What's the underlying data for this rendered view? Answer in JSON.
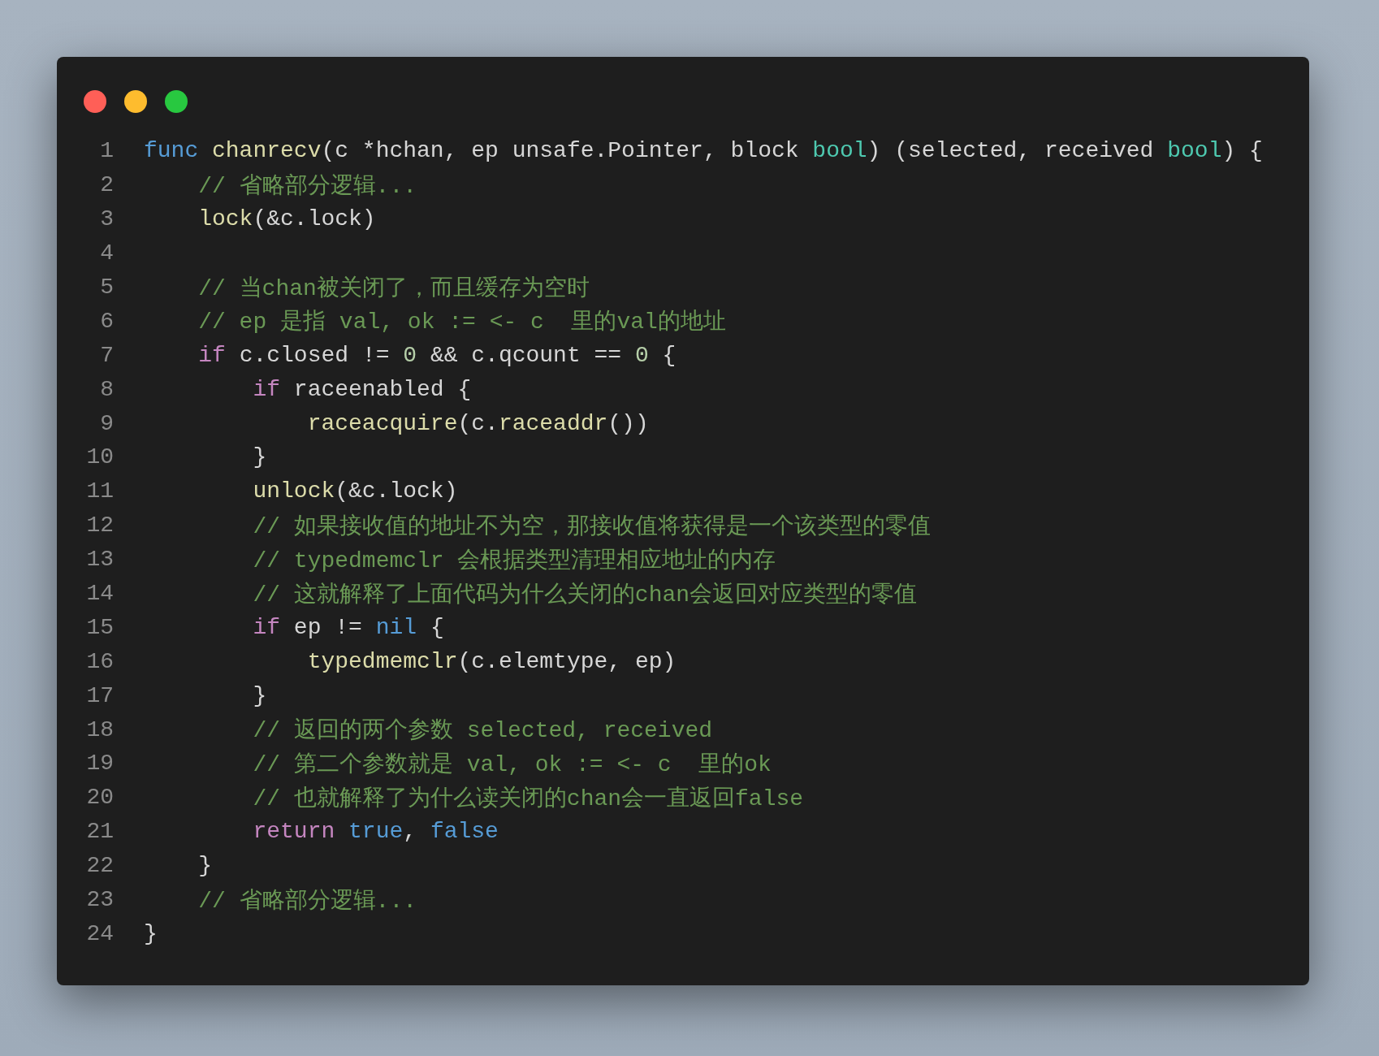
{
  "window": {
    "controls": [
      {
        "color": "#ff5f57"
      },
      {
        "color": "#febc2e"
      },
      {
        "color": "#28c840"
      }
    ]
  },
  "lines": [
    {
      "number": "1",
      "tokens": [
        {
          "kind": "storage",
          "text": "func "
        },
        {
          "kind": "function",
          "text": "chanrecv"
        },
        {
          "kind": "plain",
          "text": "(c *hchan, ep unsafe.Pointer, block "
        },
        {
          "kind": "type",
          "text": "bool"
        },
        {
          "kind": "plain",
          "text": ") (selected, received "
        },
        {
          "kind": "type",
          "text": "bool"
        },
        {
          "kind": "plain",
          "text": ") {"
        }
      ]
    },
    {
      "number": "2",
      "tokens": [
        {
          "kind": "comment",
          "text": "    // 省略部分逻辑..."
        }
      ]
    },
    {
      "number": "3",
      "tokens": [
        {
          "kind": "function",
          "text": "    lock"
        },
        {
          "kind": "plain",
          "text": "(&c.lock)"
        }
      ]
    },
    {
      "number": "4"
    },
    {
      "number": "5",
      "tokens": [
        {
          "kind": "comment",
          "text": "    // 当chan被关闭了，而且缓存为空时"
        }
      ]
    },
    {
      "number": "6",
      "tokens": [
        {
          "kind": "comment",
          "text": "    // ep 是指 val, ok := <- c  里的val的地址"
        }
      ]
    },
    {
      "number": "7",
      "tokens": [
        {
          "kind": "keyword",
          "text": "    if"
        },
        {
          "kind": "plain",
          "text": " c.closed != "
        },
        {
          "kind": "number",
          "text": "0"
        },
        {
          "kind": "plain",
          "text": " && c.qcount == "
        },
        {
          "kind": "number",
          "text": "0"
        },
        {
          "kind": "plain",
          "text": " {"
        }
      ]
    },
    {
      "number": "8",
      "tokens": [
        {
          "kind": "keyword",
          "text": "        if"
        },
        {
          "kind": "plain",
          "text": " raceenabled {"
        }
      ]
    },
    {
      "number": "9",
      "tokens": [
        {
          "kind": "function",
          "text": "            raceacquire"
        },
        {
          "kind": "plain",
          "text": "(c."
        },
        {
          "kind": "function",
          "text": "raceaddr"
        },
        {
          "kind": "plain",
          "text": "())"
        }
      ]
    },
    {
      "number": "10",
      "tokens": [
        {
          "kind": "plain",
          "text": "        }"
        }
      ]
    },
    {
      "number": "11",
      "tokens": [
        {
          "kind": "function",
          "text": "        unlock"
        },
        {
          "kind": "plain",
          "text": "(&c.lock)"
        }
      ]
    },
    {
      "number": "12",
      "tokens": [
        {
          "kind": "comment",
          "text": "        // 如果接收值的地址不为空，那接收值将获得是一个该类型的零值"
        }
      ]
    },
    {
      "number": "13",
      "tokens": [
        {
          "kind": "comment",
          "text": "        // typedmemclr 会根据类型清理相应地址的内存"
        }
      ]
    },
    {
      "number": "14",
      "tokens": [
        {
          "kind": "comment",
          "text": "        // 这就解释了上面代码为什么关闭的chan会返回对应类型的零值"
        }
      ]
    },
    {
      "number": "15",
      "tokens": [
        {
          "kind": "keyword",
          "text": "        if"
        },
        {
          "kind": "plain",
          "text": " ep != "
        },
        {
          "kind": "storage",
          "text": "nil"
        },
        {
          "kind": "plain",
          "text": " {"
        }
      ]
    },
    {
      "number": "16",
      "tokens": [
        {
          "kind": "function",
          "text": "            typedmemclr"
        },
        {
          "kind": "plain",
          "text": "(c.elemtype, ep)"
        }
      ]
    },
    {
      "number": "17",
      "tokens": [
        {
          "kind": "plain",
          "text": "        }"
        }
      ]
    },
    {
      "number": "18",
      "tokens": [
        {
          "kind": "comment",
          "text": "        // 返回的两个参数 selected, received"
        }
      ]
    },
    {
      "number": "19",
      "tokens": [
        {
          "kind": "comment",
          "text": "        // 第二个参数就是 val, ok := <- c  里的ok"
        }
      ]
    },
    {
      "number": "20",
      "tokens": [
        {
          "kind": "comment",
          "text": "        // 也就解释了为什么读关闭的chan会一直返回false"
        }
      ]
    },
    {
      "number": "21",
      "tokens": [
        {
          "kind": "keyword",
          "text": "        return "
        },
        {
          "kind": "storage",
          "text": "true"
        },
        {
          "kind": "plain",
          "text": ", "
        },
        {
          "kind": "storage",
          "text": "false"
        }
      ]
    },
    {
      "number": "22",
      "tokens": [
        {
          "kind": "plain",
          "text": "    }"
        }
      ]
    },
    {
      "number": "23",
      "tokens": [
        {
          "kind": "comment",
          "text": "    // 省略部分逻辑..."
        }
      ]
    },
    {
      "number": "24",
      "tokens": [
        {
          "kind": "plain",
          "text": "}"
        }
      ]
    }
  ]
}
